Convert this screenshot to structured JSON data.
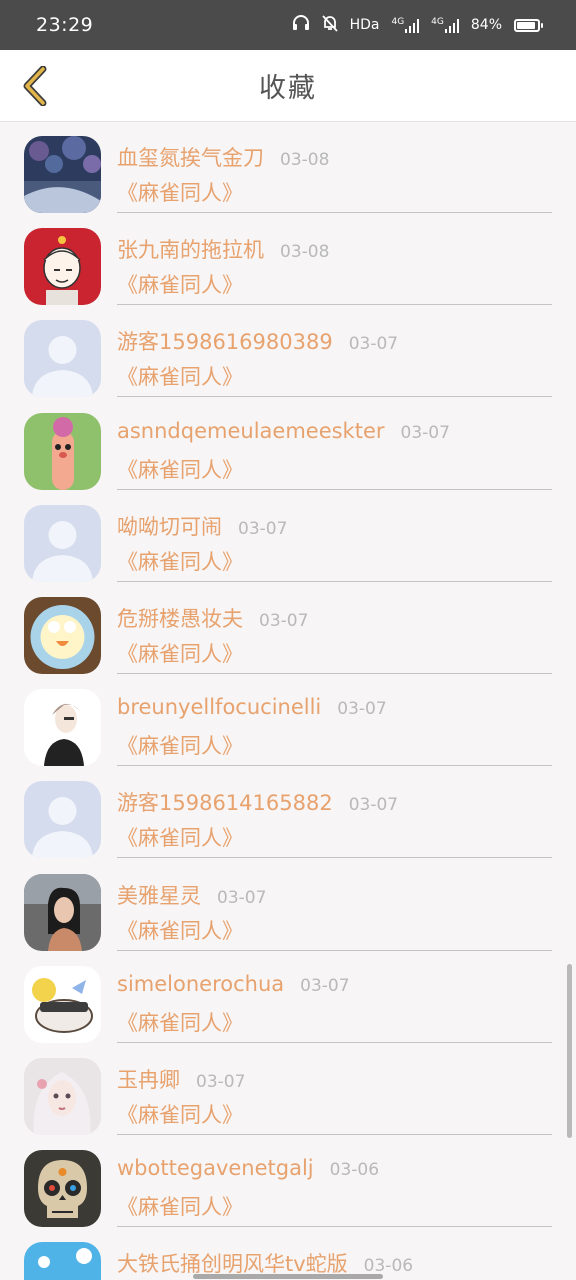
{
  "status_bar": {
    "time": "23:29",
    "hd_label": "HDa",
    "signal_1": "4G",
    "signal_2": "4G",
    "battery": "84%",
    "battery_level": 0.84
  },
  "header": {
    "title": "收藏",
    "back_icon": "chevron-left-icon",
    "accent": "#e2b54a"
  },
  "colors": {
    "name_text": "#e7a26e",
    "date_text": "#b9b9b9"
  },
  "favorites": [
    {
      "name": "血玺氮挨气金刀",
      "date": "03-08",
      "title": "《麻雀同人》",
      "avatar": "winter-forest"
    },
    {
      "name": "张九南的拖拉机",
      "date": "03-08",
      "title": "《麻雀同人》",
      "avatar": "cartoon-man"
    },
    {
      "name": "游客1598616980389",
      "date": "03-07",
      "title": "《麻雀同人》",
      "avatar": "default"
    },
    {
      "name": "asnndqemeulaemeeskter",
      "date": "03-07",
      "title": "《麻雀同人》",
      "avatar": "finger-puppet"
    },
    {
      "name": "呦呦切可闹",
      "date": "03-07",
      "title": "《麻雀同人》",
      "avatar": "default"
    },
    {
      "name": "危掰楼愚妆夫",
      "date": "03-07",
      "title": "《麻雀同人》",
      "avatar": "food-plate"
    },
    {
      "name": "breunyellfocucinelli",
      "date": "03-07",
      "title": "《麻雀同人》",
      "avatar": "anime-boy"
    },
    {
      "name": "游客1598614165882",
      "date": "03-07",
      "title": "《麻雀同人》",
      "avatar": "default"
    },
    {
      "name": "美雅星灵",
      "date": "03-07",
      "title": "《麻雀同人》",
      "avatar": "girl-photo"
    },
    {
      "name": "simelonerochua",
      "date": "03-07",
      "title": "《麻雀同人》",
      "avatar": "sushi-cartoon"
    },
    {
      "name": "玉冉卿",
      "date": "03-07",
      "title": "《麻雀同人》",
      "avatar": "doll-girl"
    },
    {
      "name": "wbottegavenetgalj",
      "date": "03-06",
      "title": "《麻雀同人》",
      "avatar": "sugar-skull"
    },
    {
      "name": "大铁氏捅创明风华tv蛇版",
      "date": "03-06",
      "title": "",
      "avatar": "sky-landscape"
    }
  ]
}
